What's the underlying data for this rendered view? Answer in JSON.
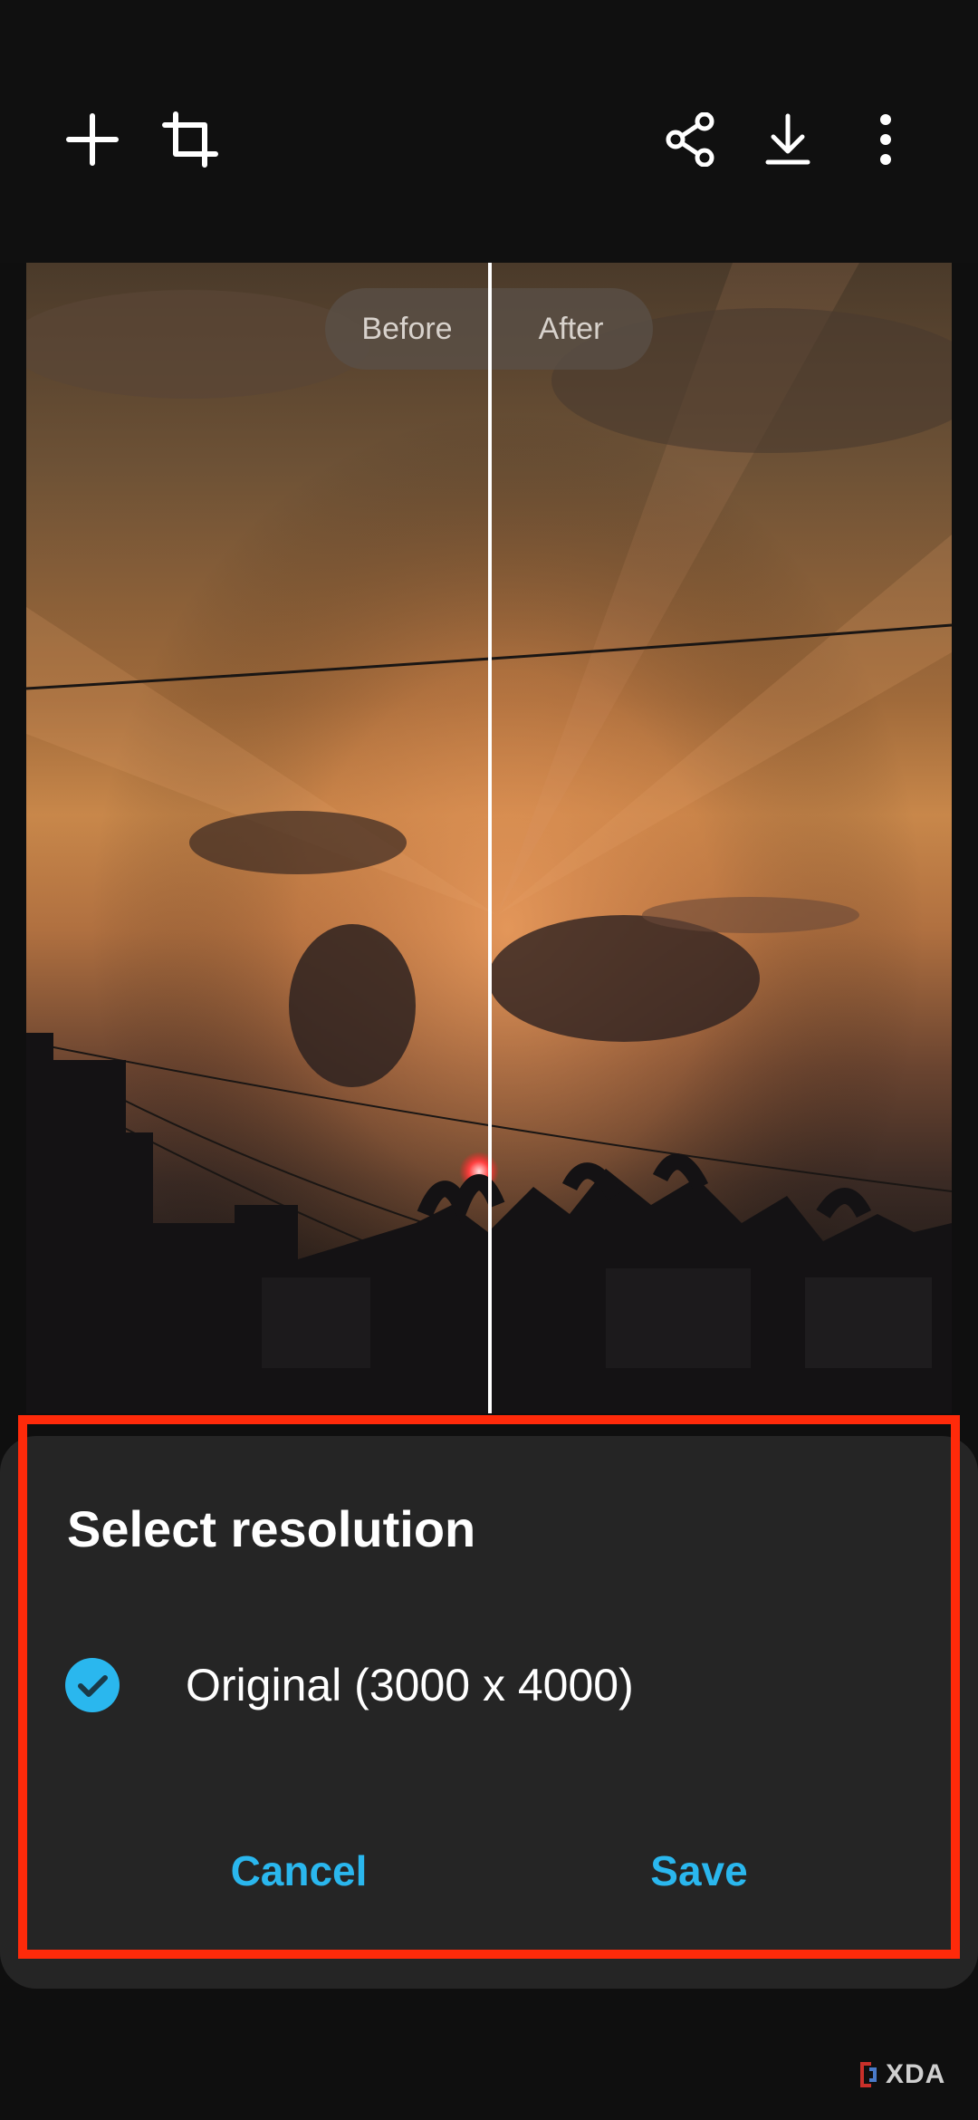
{
  "toolbar": {
    "left_icons": [
      "add-icon",
      "crop-icon"
    ],
    "right_icons": [
      "share-icon",
      "download-icon",
      "more-options-icon"
    ]
  },
  "compare": {
    "before_label": "Before",
    "after_label": "After"
  },
  "dialog": {
    "title": "Select resolution",
    "option_label": "Original (3000 x 4000)",
    "option_selected": true,
    "cancel_label": "Cancel",
    "save_label": "Save"
  },
  "watermark": {
    "text": "XDA"
  },
  "colors": {
    "accent": "#2ab7ee",
    "dialog_background": "#252525",
    "highlight_border": "#ff2a0a"
  }
}
